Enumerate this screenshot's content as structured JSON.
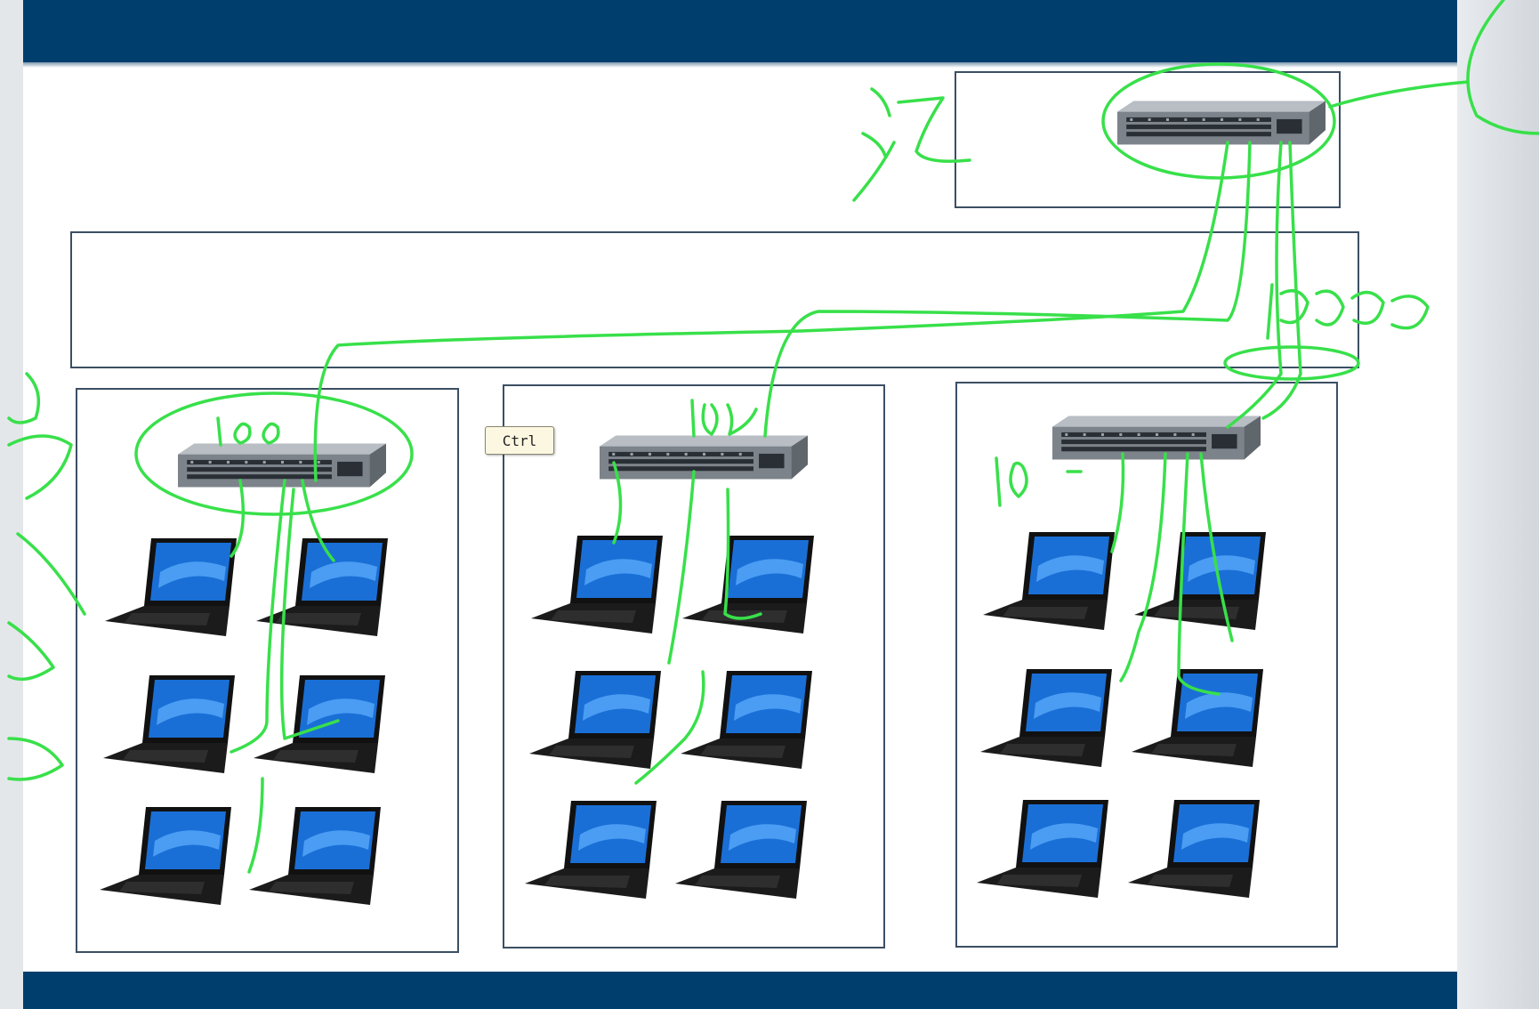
{
  "tooltip": {
    "label": "Ctrl"
  },
  "colors": {
    "slide_bar": "#003e6e",
    "box_border": "#3b4f63",
    "annotation": "#38e04a",
    "screen": "#1a6fd6"
  },
  "diagram": {
    "core_switch": {
      "icon": "network-switch-icon"
    },
    "groups": [
      {
        "switch_icon": "network-switch-icon",
        "laptop_count": 6
      },
      {
        "switch_icon": "network-switch-icon",
        "laptop_count": 6
      },
      {
        "switch_icon": "network-switch-icon",
        "laptop_count": 6
      }
    ]
  }
}
